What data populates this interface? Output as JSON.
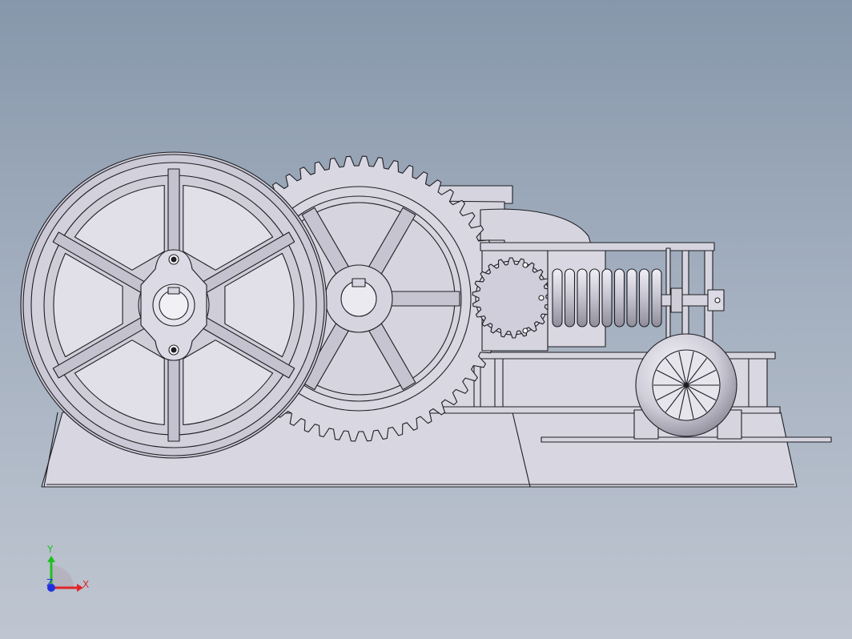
{
  "viewport": {
    "background_top": "#8797ab",
    "background_bottom": "#bfc6d1",
    "model_fill": "#d6d4de",
    "model_stroke": "#1e1e24"
  },
  "triad": {
    "x_label": "X",
    "y_label": "Y",
    "z_label": "Z",
    "x_color": "#e0262a",
    "y_color": "#20c020",
    "z_color": "#2030e0"
  },
  "model": {
    "components": [
      "flywheel",
      "spur-gear",
      "pinion",
      "compression-spring",
      "bearing-housing",
      "frame-base",
      "drive-wheel",
      "guide-rod"
    ],
    "flywheel_spokes": 6,
    "gear_teeth": 56
  }
}
